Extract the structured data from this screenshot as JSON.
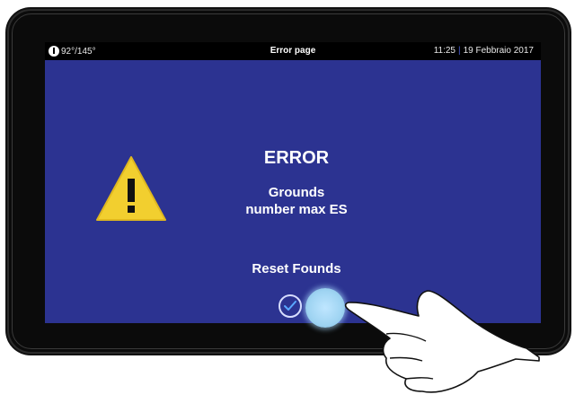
{
  "status": {
    "temperature": "92°/145°",
    "title": "Error page",
    "time": "11:25",
    "separator": "|",
    "date": "19 Febbraio 2017"
  },
  "error": {
    "heading": "ERROR",
    "message_line1": "Grounds",
    "message_line2": "number max ES",
    "action_label": "Reset Founds"
  },
  "colors": {
    "screen_bg": "#2c3391",
    "warning_yellow": "#f2cf2f",
    "touch_highlight": "#bfe6ff"
  },
  "icons": [
    "thermometer-icon",
    "warning-icon",
    "checkmark-icon",
    "pointing-hand-icon"
  ]
}
